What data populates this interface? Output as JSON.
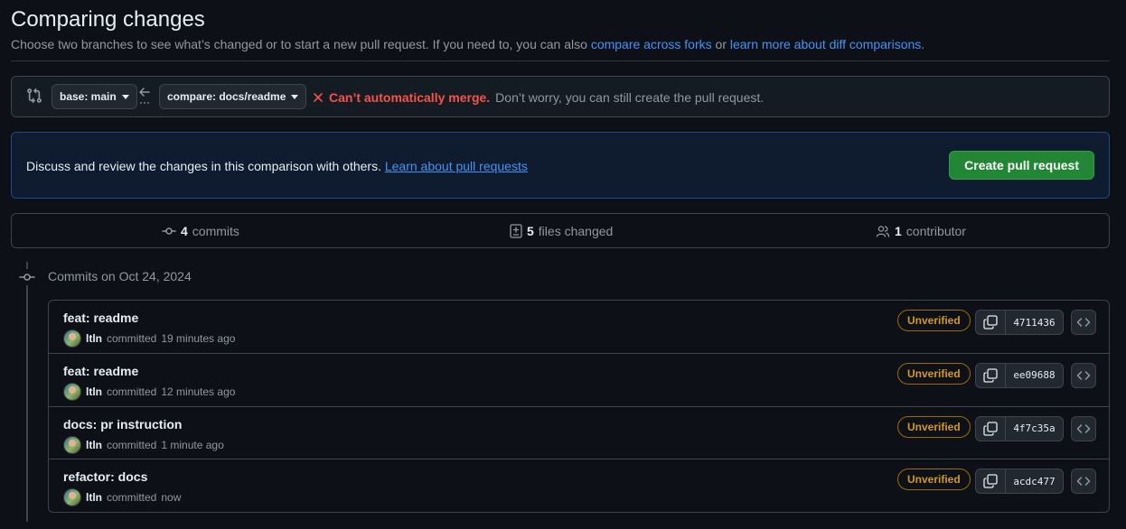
{
  "header": {
    "title": "Comparing changes",
    "subtitle_prefix": "Choose two branches to see what’s changed or to start a new pull request. If you need to, you can also ",
    "link_forks": "compare across forks",
    "subtitle_mid": " or ",
    "link_diff": "learn more about diff comparisons",
    "subtitle_suffix": "."
  },
  "range": {
    "base_label": "base: main",
    "compare_label": "compare: docs/readme",
    "merge_error": "Can’t automatically merge.",
    "merge_note": "Don’t worry, you can still create the pull request."
  },
  "pr_banner": {
    "text": "Discuss and review the changes in this comparison with others.",
    "link": "Learn about pull requests",
    "button": "Create pull request"
  },
  "stats": {
    "commits_count": "4",
    "commits_label": "commits",
    "files_count": "5",
    "files_label": "files changed",
    "contributors_count": "1",
    "contributors_label": "contributor"
  },
  "timeline": {
    "date_label": "Commits on Oct 24, 2024"
  },
  "commits": [
    {
      "message": "feat: readme",
      "author": "ltln",
      "action": "committed",
      "time": "19 minutes ago",
      "badge": "Unverified",
      "sha": "4711436"
    },
    {
      "message": "feat: readme",
      "author": "ltln",
      "action": "committed",
      "time": "12 minutes ago",
      "badge": "Unverified",
      "sha": "ee09688"
    },
    {
      "message": "docs: pr instruction",
      "author": "ltln",
      "action": "committed",
      "time": "1 minute ago",
      "badge": "Unverified",
      "sha": "4f7c35a"
    },
    {
      "message": "refactor: docs",
      "author": "ltln",
      "action": "committed",
      "time": "now",
      "badge": "Unverified",
      "sha": "acdc477"
    }
  ],
  "colors": {
    "background": "#0d1117",
    "accent_link": "#4493f8",
    "error": "#f85149",
    "success_button": "#238636",
    "warning": "#d29922"
  }
}
